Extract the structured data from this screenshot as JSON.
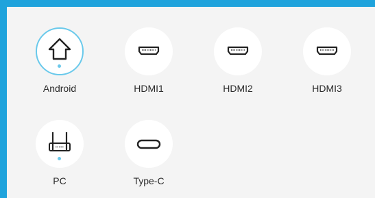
{
  "sources": [
    {
      "label": "Android",
      "icon": "home-icon",
      "selected": true,
      "active": true
    },
    {
      "label": "HDMI1",
      "icon": "hdmi-port-icon",
      "selected": false,
      "active": false
    },
    {
      "label": "HDMI2",
      "icon": "hdmi-port-icon",
      "selected": false,
      "active": false
    },
    {
      "label": "HDMI3",
      "icon": "hdmi-port-icon",
      "selected": false,
      "active": false
    },
    {
      "label": "PC",
      "icon": "pc-router-icon",
      "selected": false,
      "active": true
    },
    {
      "label": "Type-C",
      "icon": "usb-c-port-icon",
      "selected": false,
      "active": false
    }
  ],
  "colors": {
    "frame": "#1fa3dc",
    "panel": "#f4f4f4",
    "selected_ring": "#69c9eb",
    "active_dot": "#6cc8ea",
    "icon_stroke": "#222222"
  }
}
